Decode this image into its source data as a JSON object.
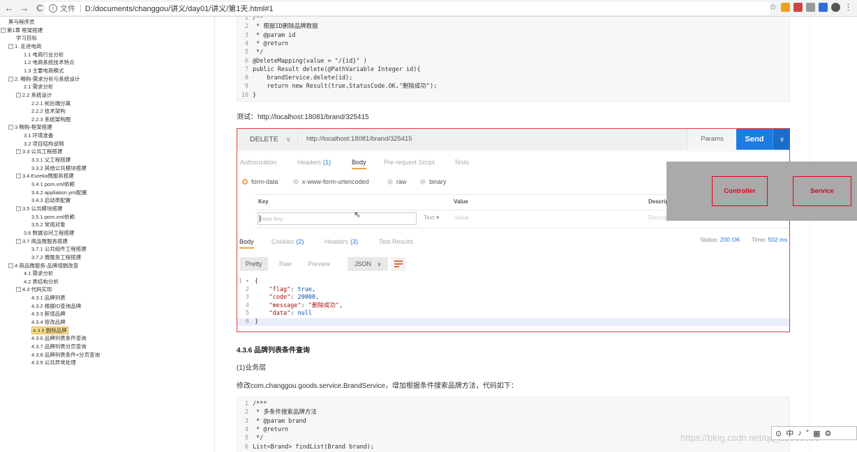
{
  "browser": {
    "back": "←",
    "forward": "→",
    "reload": "C",
    "info": "i",
    "scheme": "文件",
    "sep": "|",
    "url": "D:/documents/changgou/讲义/day01/讲义/第1天.html#1"
  },
  "toc": {
    "items": [
      {
        "label": "黑马程序员",
        "toggle": ""
      },
      {
        "label": "第1章 框架搭建",
        "toggle": "-"
      },
      {
        "label": "学习目标",
        "toggle": ""
      },
      {
        "label": "1. 走进电商",
        "toggle": "-"
      },
      {
        "label": "1.1 电商行业分析",
        "toggle": ""
      },
      {
        "label": "1.2 电商系统技术特点",
        "toggle": ""
      },
      {
        "label": "1.3 主要电商模式",
        "toggle": ""
      },
      {
        "label": "2. 畅购-需求分析与系统设计",
        "toggle": "-"
      },
      {
        "label": "2.1 需求分析",
        "toggle": ""
      },
      {
        "label": "2.2 系统设计",
        "toggle": "-"
      },
      {
        "label": "2.2.1 前后端分离",
        "toggle": ""
      },
      {
        "label": "2.2.2 技术架构",
        "toggle": ""
      },
      {
        "label": "2.2.3 系统架构图",
        "toggle": ""
      },
      {
        "label": "3 畅购-框架搭建",
        "toggle": "-"
      },
      {
        "label": "3.1 环境准备",
        "toggle": ""
      },
      {
        "label": "3.2 项目结构说明",
        "toggle": ""
      },
      {
        "label": "3.3 公共工程搭建",
        "toggle": "-"
      },
      {
        "label": "3.3.1 父工程搭建",
        "toggle": ""
      },
      {
        "label": "3.3.2 其他公共模块搭建",
        "toggle": ""
      },
      {
        "label": "3.4 Eureka微服务搭建",
        "toggle": "-"
      },
      {
        "label": "3.4.1 pom.xml依赖",
        "toggle": ""
      },
      {
        "label": "3.4.2 appliation.yml配置",
        "toggle": ""
      },
      {
        "label": "3.4.3 启动类配置",
        "toggle": ""
      },
      {
        "label": "3.5 公共模块搭建",
        "toggle": "-"
      },
      {
        "label": "3.5.1 pom.xml依赖",
        "toggle": ""
      },
      {
        "label": "3.5.2 常用对象",
        "toggle": ""
      },
      {
        "label": "3.6 数据访问工程搭建",
        "toggle": ""
      },
      {
        "label": "3.7 商品微服务搭建",
        "toggle": "-"
      },
      {
        "label": "3.7.1 公共组件工程搭建",
        "toggle": ""
      },
      {
        "label": "3.7.2 微服务工程搭建",
        "toggle": ""
      },
      {
        "label": "4 商品微服务-品牌增删改查",
        "toggle": "-"
      },
      {
        "label": "4.1 需求分析",
        "toggle": ""
      },
      {
        "label": "4.2 表结构分析",
        "toggle": ""
      },
      {
        "label": "4.3 代码实现",
        "toggle": "-"
      },
      {
        "label": "4.3.1 品牌列表",
        "toggle": ""
      },
      {
        "label": "4.3.2 根据ID查询品牌",
        "toggle": ""
      },
      {
        "label": "4.3.3 新增品牌",
        "toggle": ""
      },
      {
        "label": "4.3.4 修改品牌",
        "toggle": ""
      },
      {
        "label": "4.3.5 删除品牌",
        "toggle": ""
      },
      {
        "label": "4.3.6 品牌列表条件查询",
        "toggle": ""
      },
      {
        "label": "4.3.7 品牌列表分页查询",
        "toggle": ""
      },
      {
        "label": "4.3.8 品牌列表条件+分页查询",
        "toggle": ""
      },
      {
        "label": "4.3.9 公共异常处理",
        "toggle": ""
      }
    ],
    "active_label": "4.3.5 删除品牌"
  },
  "code1": {
    "lines": [
      {
        "n": "1",
        "t": "/**"
      },
      {
        "n": "2",
        "t": " * 根据ID删除品牌数据"
      },
      {
        "n": "3",
        "t": " * @param id"
      },
      {
        "n": "4",
        "t": " * @return"
      },
      {
        "n": "5",
        "t": " */"
      },
      {
        "n": "6",
        "t": "@DeleteMapping(value = \"/{id}\" )"
      },
      {
        "n": "7",
        "t": "public Result delete(@PathVariable Integer id){"
      },
      {
        "n": "8",
        "t": "    brandService.delete(id);"
      },
      {
        "n": "9",
        "t": "    return new Result(true,StatusCode.OK,\"删除成功\");"
      },
      {
        "n": "10",
        "t": "}"
      }
    ]
  },
  "test_line": "测试：http://localhost:18081/brand/325415",
  "postman": {
    "method": "DELETE",
    "method_caret": "∨",
    "url": "http://localhost:18081/brand/325415",
    "params_label": "Params",
    "send_label": "Send",
    "send_caret": "∨",
    "request_tabs": [
      {
        "label": "Authorization",
        "count": ""
      },
      {
        "label": "Headers",
        "count": "(1)"
      },
      {
        "label": "Body",
        "count": ""
      },
      {
        "label": "Pre-request Script",
        "count": ""
      },
      {
        "label": "Tests",
        "count": ""
      }
    ],
    "body_modes": [
      "form-data",
      "x-www-form-urlencoded",
      "raw",
      "binary"
    ],
    "kv_headers": {
      "key": "Key",
      "value": "Value",
      "desc": "Descrip"
    },
    "kv_placeholders": {
      "key": "New key",
      "type": "Text ▾",
      "value": "Value",
      "desc": "Description"
    },
    "response_tabs": [
      {
        "label": "Body",
        "count": ""
      },
      {
        "label": "Cookies",
        "count": "(2)"
      },
      {
        "label": "Headers",
        "count": "(3)"
      },
      {
        "label": "Test Results",
        "count": ""
      }
    ],
    "status_label": "Status:",
    "status_value": "200 OK",
    "time_label": "Time:",
    "time_value": "502 ms",
    "view_modes": [
      "Pretty",
      "Raw",
      "Preview"
    ],
    "format": "JSON",
    "format_caret": "∨",
    "json": [
      {
        "n": "1 ▾",
        "t": "{"
      },
      {
        "n": "2",
        "k": "\"flag\"",
        "v": "true,"
      },
      {
        "n": "3",
        "k": "\"code\"",
        "v": "20000,"
      },
      {
        "n": "4",
        "k": "\"message\"",
        "v": "\"删除成功\","
      },
      {
        "n": "5",
        "k": "\"data\"",
        "v": "null"
      },
      {
        "n": "6",
        "t": "}"
      }
    ]
  },
  "overlay": {
    "controller": "Controller",
    "service": "Service"
  },
  "section_436": {
    "heading": "4.3.6 品牌列表条件查询",
    "sub": "(1)业务层",
    "desc": "修改com.changgou.goods.service.BrandService，增加根据条件搜索品牌方法，代码如下："
  },
  "code2": {
    "lines": [
      {
        "n": "1",
        "t": "/***"
      },
      {
        "n": "2",
        "t": " * 多条件搜索品牌方法"
      },
      {
        "n": "3",
        "t": " * @param brand"
      },
      {
        "n": "4",
        "t": " * @return"
      },
      {
        "n": "5",
        "t": " */"
      },
      {
        "n": "6",
        "t": "List<Brand> findList(Brand brand);"
      }
    ]
  },
  "ime": [
    "⊙",
    "中",
    "♪",
    "°",
    "▦",
    "⚙"
  ],
  "watermark": "https://blog.csdn.net/qq_38600000",
  "colors": {
    "accent": "#1e7be1",
    "highlight_border": "#e4393c",
    "active_tab": "#f0a23c"
  }
}
